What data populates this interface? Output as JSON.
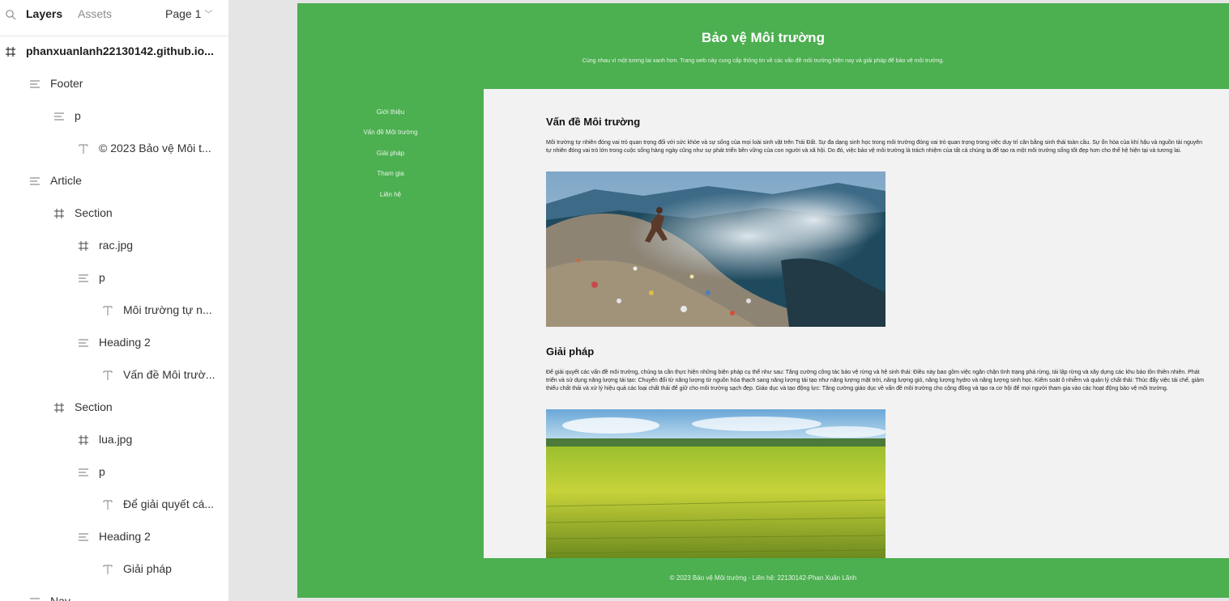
{
  "panel": {
    "tabs": {
      "layers": "Layers",
      "assets": "Assets"
    },
    "page_select": "Page 1",
    "layers": [
      {
        "label": "phanxuanlanh22130142.github.io...",
        "kind": "frame",
        "depth": 0
      },
      {
        "label": "Footer",
        "kind": "stack",
        "depth": 1
      },
      {
        "label": "p",
        "kind": "stack",
        "depth": 2
      },
      {
        "label": "© 2023 Bảo vệ Môi t...",
        "kind": "text",
        "depth": 3
      },
      {
        "label": "Article",
        "kind": "stack",
        "depth": 1
      },
      {
        "label": "Section",
        "kind": "frame",
        "depth": 2
      },
      {
        "label": "rac.jpg",
        "kind": "frame",
        "depth": 3
      },
      {
        "label": "p",
        "kind": "stack",
        "depth": 3
      },
      {
        "label": "Môi trường tự n...",
        "kind": "text",
        "depth": 4
      },
      {
        "label": "Heading 2",
        "kind": "stack",
        "depth": 3
      },
      {
        "label": "Vấn đề Môi trườ...",
        "kind": "text",
        "depth": 4
      },
      {
        "label": "Section",
        "kind": "frame",
        "depth": 2
      },
      {
        "label": "lua.jpg",
        "kind": "frame",
        "depth": 3
      },
      {
        "label": "p",
        "kind": "stack",
        "depth": 3
      },
      {
        "label": "Để giải quyết cá...",
        "kind": "text",
        "depth": 4
      },
      {
        "label": "Heading 2",
        "kind": "stack",
        "depth": 3
      },
      {
        "label": "Giải pháp",
        "kind": "text",
        "depth": 4
      },
      {
        "label": "Nav",
        "kind": "stack",
        "depth": 1
      }
    ]
  },
  "site": {
    "title": "Bảo vệ Môi trường",
    "tagline": "Cùng nhau vì một tương lai xanh hơn. Trang web này cung cấp thông tin về các vấn đề môi trường hiện nay và giải pháp để bảo vệ môi trường.",
    "nav": [
      "Giới thiệu",
      "Vấn đề Môi trường",
      "Giải pháp",
      "Tham gia",
      "Liên hệ"
    ],
    "sections": [
      {
        "title": "Vấn đề Môi trường",
        "paragraph": "Môi trường tự nhiên đóng vai trò quan trọng đối với sức khỏe và sự sống của mọi loài sinh vật trên Trái Đất. Sự đa dạng sinh học trong môi trường đóng vai trò quan trọng trong việc duy trì cân bằng sinh thái toàn cầu. Sự ổn hòa của khí hậu và nguồn tài nguyên tự nhiên đóng vai trò lớn trong cuộc sống hàng ngày cũng như sự phát triển bền vững của con người và xã hội. Do đó, việc bảo vệ môi trường là trách nhiệm của tất cả chúng ta để tạo ra một môi trường sống tốt đẹp hơn cho thế hệ hiện tại và tương lai."
      },
      {
        "title": "Giải pháp",
        "paragraph": "Để giải quyết các vấn đề môi trường, chúng ta cần thực hiện những biện pháp cụ thể như sau: Tăng cường công tác bảo vệ rừng và hệ sinh thái: Điều này bao gồm việc ngăn chặn tình trạng phá rừng, tái lập rừng và xây dựng các khu bảo tồn thiên nhiên. Phát triển và sử dụng năng lượng tái tạo: Chuyển đổi từ năng lượng từ nguồn hóa thạch sang năng lượng tái tạo như năng lượng mặt trời, năng lượng gió, năng lượng hydro và năng lượng sinh học. Kiểm soát ô nhiễm và quản lý chất thải: Thúc đẩy việc tái chế, giảm thiểu chất thải và xử lý hiệu quả các loại chất thải để giữ cho môi trường sạch đẹp. Giáo dục và tạo động lực: Tăng cường giáo dục về vấn đề môi trường cho cộng đồng và tạo ra cơ hội để mọi người tham gia vào các hoạt động bảo vệ môi trường."
      }
    ],
    "footer": "© 2023 Bảo vệ Môi trường - Liên hệ: 22130142-Phan Xuân Lãnh"
  },
  "colors": {
    "brand_green": "#4caf50",
    "article_bg": "#f2f2f2"
  }
}
